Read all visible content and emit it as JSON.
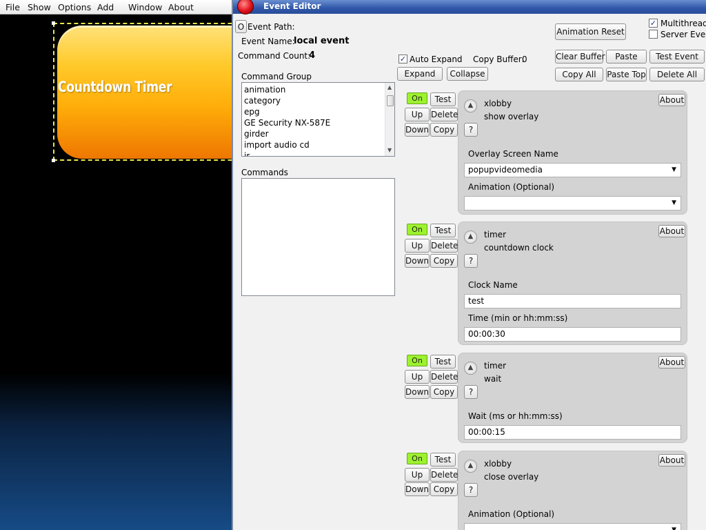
{
  "menu": [
    "File",
    "Show",
    "Options",
    "Add",
    "Window",
    "About"
  ],
  "widget": {
    "label": "Countdown Timer"
  },
  "editor": {
    "title": "Event Editor",
    "path_button": "O",
    "event_path_label": "Event Path:",
    "event_name_label": "Event Name:",
    "event_name": "local event",
    "command_count_label": "Command Count:",
    "command_count": "4",
    "animation_reset": "Animation Reset",
    "multithreaded": "Multithreaded",
    "server_event": "Server Event",
    "auto_expand": "Auto Expand",
    "copy_buffer_label": "Copy Buffer:",
    "copy_buffer": "0",
    "clear_buffer": "Clear Buffer",
    "paste": "Paste",
    "test_event": "Test Event",
    "expand": "Expand",
    "collapse": "Collapse",
    "copy_all": "Copy All",
    "paste_top": "Paste Top",
    "delete_all": "Delete All",
    "command_group_label": "Command Group",
    "command_groups": [
      "animation",
      "category",
      "epg",
      "GE Security NX-587E",
      "girder",
      "import audio cd",
      "ir"
    ],
    "commands_label": "Commands"
  },
  "buttons": {
    "on": "On",
    "test": "Test",
    "up": "Up",
    "delete": "Delete",
    "down": "Down",
    "copy": "Copy",
    "about": "About",
    "help": "?"
  },
  "commands": [
    {
      "category": "xlobby",
      "name": "show overlay",
      "fields": [
        {
          "label": "Overlay Screen Name",
          "value": "popupvideomedia",
          "dropdown": true
        },
        {
          "label": "Animation (Optional)",
          "value": "",
          "dropdown": true
        }
      ]
    },
    {
      "category": "timer",
      "name": "countdown clock",
      "fields": [
        {
          "label": "Clock Name",
          "value": "test",
          "dropdown": false
        },
        {
          "label": "Time (min or hh:mm:ss)",
          "value": "00:00:30",
          "dropdown": false
        }
      ]
    },
    {
      "category": "timer",
      "name": "wait",
      "fields": [
        {
          "label": "Wait (ms or hh:mm:ss)",
          "value": "00:00:15",
          "dropdown": false
        }
      ]
    },
    {
      "category": "xlobby",
      "name": "close overlay",
      "fields": [
        {
          "label": "Animation (Optional)",
          "value": "",
          "dropdown": true
        }
      ]
    }
  ]
}
